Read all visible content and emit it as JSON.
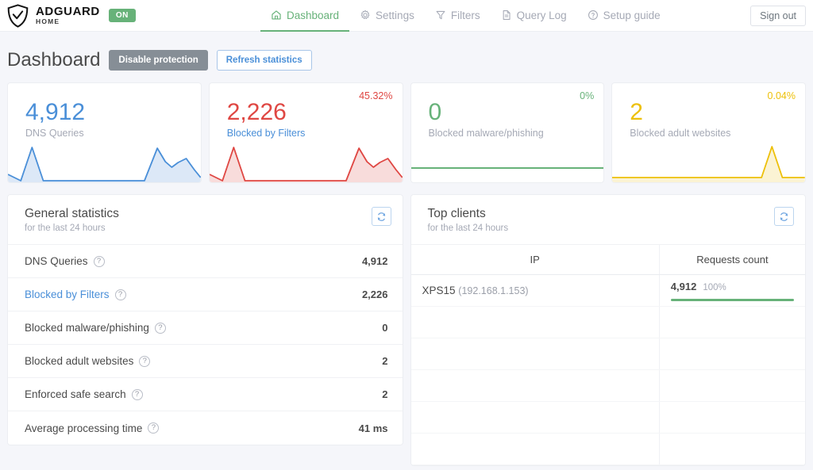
{
  "brand": {
    "name": "ADGUARD",
    "sub": "HOME",
    "badge": "ON",
    "shield_icon": "shield-check-icon"
  },
  "nav": {
    "items": [
      {
        "label": "Dashboard",
        "icon": "home-icon",
        "active": true
      },
      {
        "label": "Settings",
        "icon": "gear-icon",
        "active": false
      },
      {
        "label": "Filters",
        "icon": "funnel-icon",
        "active": false
      },
      {
        "label": "Query Log",
        "icon": "document-icon",
        "active": false
      },
      {
        "label": "Setup guide",
        "icon": "question-circle-icon",
        "active": false
      }
    ],
    "sign_out": "Sign out"
  },
  "page": {
    "title": "Dashboard",
    "disable_protection": "Disable protection",
    "refresh_statistics": "Refresh statistics"
  },
  "cards": [
    {
      "value": "4,912",
      "label": "DNS Queries",
      "percent": "",
      "color": "#4a8fd8",
      "label_color": "#a5a9b5",
      "label_link": false
    },
    {
      "value": "2,226",
      "label": "Blocked by Filters",
      "percent": "45.32%",
      "color": "#df4743",
      "label_color": "#4a8fd8",
      "label_link": true
    },
    {
      "value": "0",
      "label": "Blocked malware/phishing",
      "percent": "0%",
      "color": "#67b279",
      "label_color": "#a5a9b5",
      "label_link": false
    },
    {
      "value": "2",
      "label": "Blocked adult websites",
      "percent": "0.04%",
      "color": "#edc00a",
      "label_color": "#a5a9b5",
      "label_link": false
    }
  ],
  "general_statistics": {
    "title": "General statistics",
    "subtitle": "for the last 24 hours",
    "refresh_icon": "refresh-icon",
    "rows": [
      {
        "label": "DNS Queries",
        "value": "4,912",
        "link": false,
        "help": "?"
      },
      {
        "label": "Blocked by Filters",
        "value": "2,226",
        "link": true,
        "help": "?"
      },
      {
        "label": "Blocked malware/phishing",
        "value": "0",
        "link": false,
        "help": "?"
      },
      {
        "label": "Blocked adult websites",
        "value": "2",
        "link": false,
        "help": "?"
      },
      {
        "label": "Enforced safe search",
        "value": "2",
        "link": false,
        "help": "?"
      },
      {
        "label": "Average processing time",
        "value": "41 ms",
        "link": false,
        "help": "?"
      }
    ]
  },
  "top_clients": {
    "title": "Top clients",
    "subtitle": "for the last 24 hours",
    "refresh_icon": "refresh-icon",
    "columns": {
      "ip": "IP",
      "requests": "Requests count"
    },
    "rows": [
      {
        "host": "XPS15",
        "ip": "(192.168.1.153)",
        "count": "4,912",
        "percent": "100%",
        "bar_pct": 100
      }
    ],
    "empty_rows": 5
  },
  "colors": {
    "accent_blue": "#4a8fd8",
    "green": "#67b279",
    "red": "#df4743",
    "yellow": "#edc00a",
    "page_bg": "#f5f6fa"
  },
  "chart_data": [
    {
      "type": "area",
      "title": "DNS Queries sparkline",
      "color": "#4a8fd8",
      "x": [
        0,
        4,
        8,
        12,
        16,
        20,
        24,
        28,
        32,
        36,
        40,
        44,
        48,
        52,
        56,
        60,
        64,
        68,
        72,
        76,
        80,
        84,
        88,
        92,
        96,
        100
      ],
      "values": [
        18,
        6,
        2,
        62,
        2,
        2,
        2,
        2,
        2,
        2,
        2,
        2,
        2,
        2,
        2,
        2,
        2,
        2,
        2,
        62,
        34,
        24,
        30,
        40,
        26,
        8
      ]
    },
    {
      "type": "area",
      "title": "Blocked by Filters sparkline",
      "color": "#df4743",
      "x": [
        0,
        4,
        8,
        12,
        16,
        20,
        24,
        28,
        32,
        36,
        40,
        44,
        48,
        52,
        56,
        60,
        64,
        68,
        72,
        76,
        80,
        84,
        88,
        92,
        96,
        100
      ],
      "values": [
        18,
        6,
        2,
        62,
        2,
        2,
        2,
        2,
        2,
        2,
        2,
        2,
        2,
        2,
        2,
        2,
        2,
        2,
        2,
        62,
        34,
        24,
        30,
        40,
        26,
        8
      ]
    },
    {
      "type": "line",
      "title": "Blocked malware/phishing sparkline",
      "color": "#67b279",
      "x": [
        0,
        20,
        40,
        60,
        80,
        100
      ],
      "values": [
        0,
        0,
        0,
        0,
        0,
        0
      ]
    },
    {
      "type": "area",
      "title": "Blocked adult websites sparkline",
      "color": "#edc00a",
      "x": [
        0,
        20,
        40,
        60,
        76,
        83,
        90,
        100
      ],
      "values": [
        0,
        0,
        0,
        0,
        0,
        62,
        0,
        0
      ]
    }
  ]
}
